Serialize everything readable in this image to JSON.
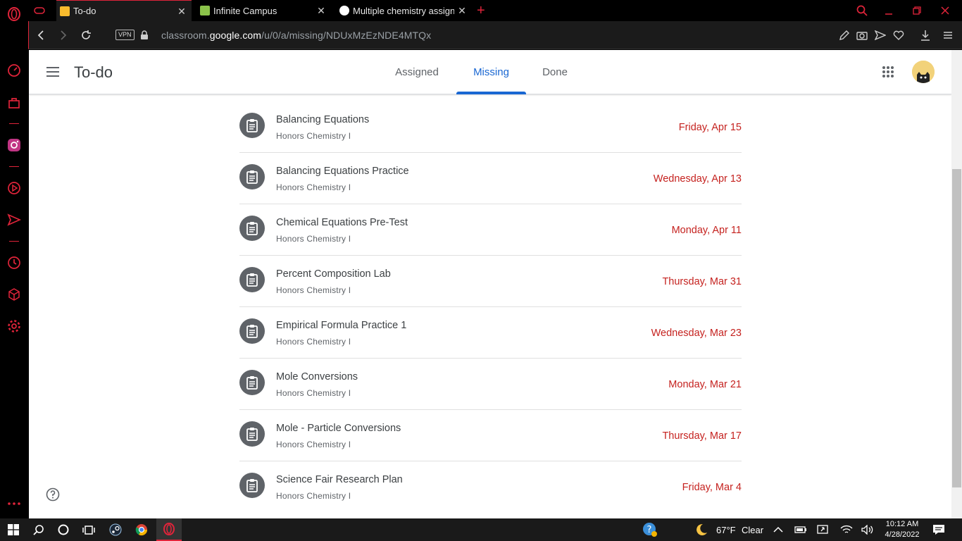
{
  "browser": {
    "tabs": [
      {
        "label": "To-do",
        "active": true,
        "favicon": "classroom-favicon"
      },
      {
        "label": "Infinite Campus",
        "active": false,
        "favicon": "infinite-campus-favicon"
      },
      {
        "label": "Multiple chemistry assignm",
        "active": false,
        "favicon": "openai-favicon"
      }
    ],
    "address": {
      "prefix": "classroom.",
      "domain": "google.com",
      "path": "/u/0/a/missing/NDUxMzEzNDE4MTQx",
      "vpn_label": "VPN"
    },
    "accent": "#e0243a"
  },
  "page": {
    "title": "To-do",
    "tabs": [
      {
        "label": "Assigned",
        "active": false
      },
      {
        "label": "Missing",
        "active": true
      },
      {
        "label": "Done",
        "active": false
      }
    ],
    "accent": "#1967d2",
    "due_color": "#c5221f",
    "assignments": [
      {
        "title": "Balancing Equations",
        "course": "Honors Chemistry I",
        "due": "Friday, Apr 15"
      },
      {
        "title": "Balancing Equations Practice",
        "course": "Honors Chemistry I",
        "due": "Wednesday, Apr 13"
      },
      {
        "title": "Chemical Equations Pre-Test",
        "course": "Honors Chemistry I",
        "due": "Monday, Apr 11"
      },
      {
        "title": "Percent Composition Lab",
        "course": "Honors Chemistry I",
        "due": "Thursday, Mar 31"
      },
      {
        "title": "Empirical Formula Practice 1",
        "course": "Honors Chemistry I",
        "due": "Wednesday, Mar 23"
      },
      {
        "title": "Mole Conversions",
        "course": "Honors Chemistry I",
        "due": "Monday, Mar 21"
      },
      {
        "title": "Mole - Particle Conversions",
        "course": "Honors Chemistry I",
        "due": "Thursday, Mar 17"
      },
      {
        "title": "Science Fair Research Plan",
        "course": "Honors Chemistry I",
        "due": "Friday, Mar 4"
      }
    ]
  },
  "taskbar": {
    "weather_temp": "67°F",
    "weather_text": "Clear",
    "time": "10:12 AM",
    "date": "4/28/2022"
  }
}
